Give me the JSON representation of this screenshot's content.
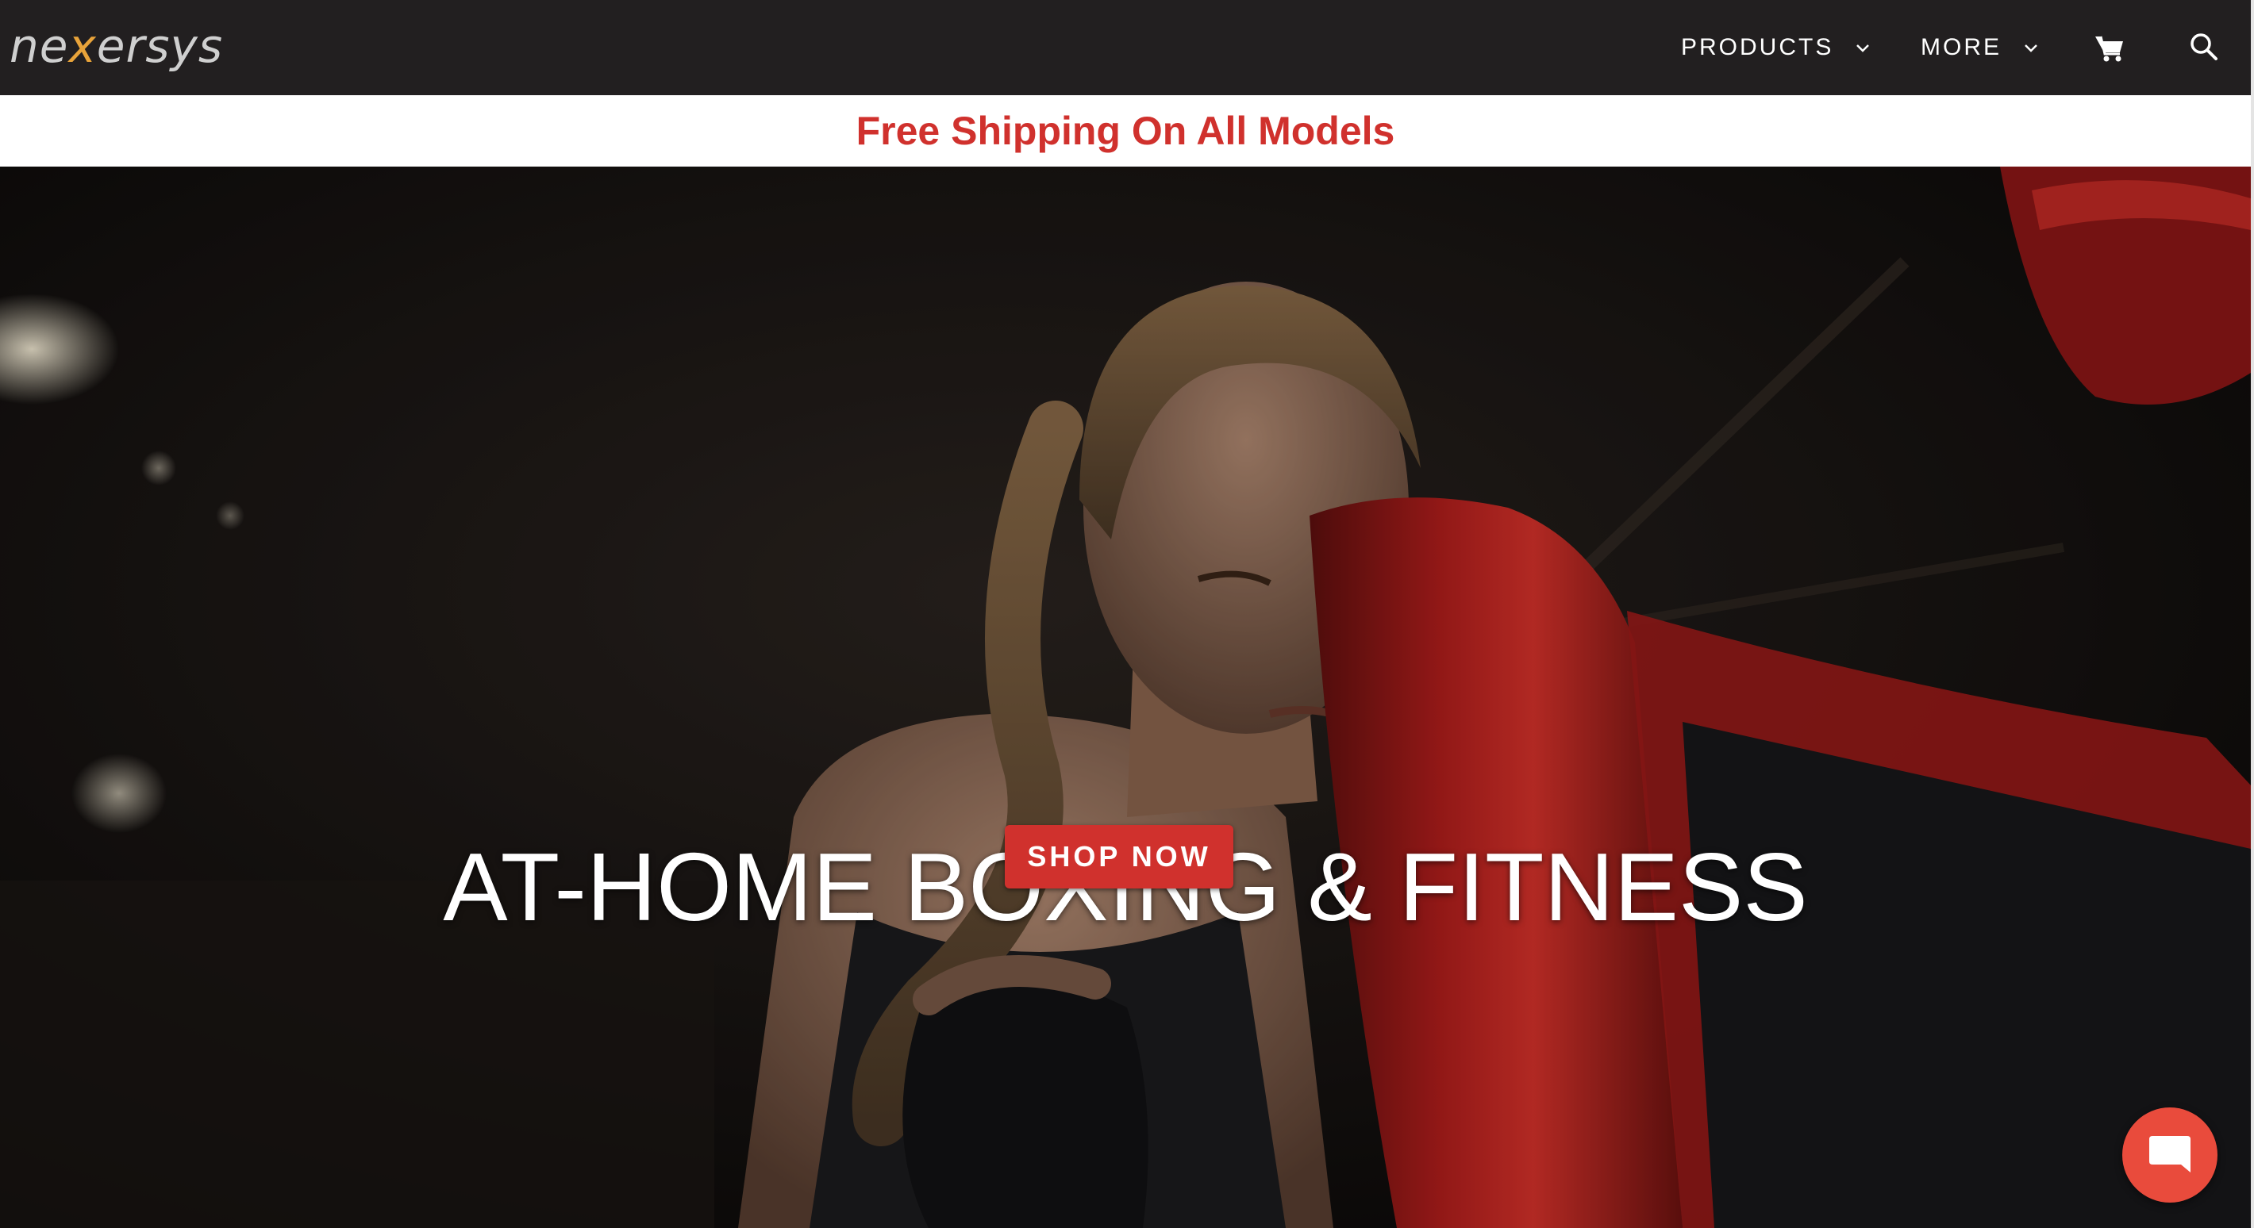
{
  "header": {
    "logo_text_1": "ne",
    "logo_text_accent": "x",
    "logo_text_2": "ersys",
    "nav": [
      {
        "label": "PRODUCTS"
      },
      {
        "label": "MORE"
      }
    ],
    "icons": [
      "cart-icon",
      "search-icon",
      "chevron-down-icon"
    ]
  },
  "promo": {
    "text": "Free Shipping On All Models"
  },
  "hero": {
    "title": "AT-HOME BOXING & FITNESS",
    "cta_label": "SHOP NOW"
  },
  "chat": {
    "icon": "chat-bubble-icon"
  },
  "colors": {
    "topbar": "#221f20",
    "brand_red": "#d0312d",
    "chat_red": "#e94b3c",
    "logo_accent": "#e8a33a"
  }
}
